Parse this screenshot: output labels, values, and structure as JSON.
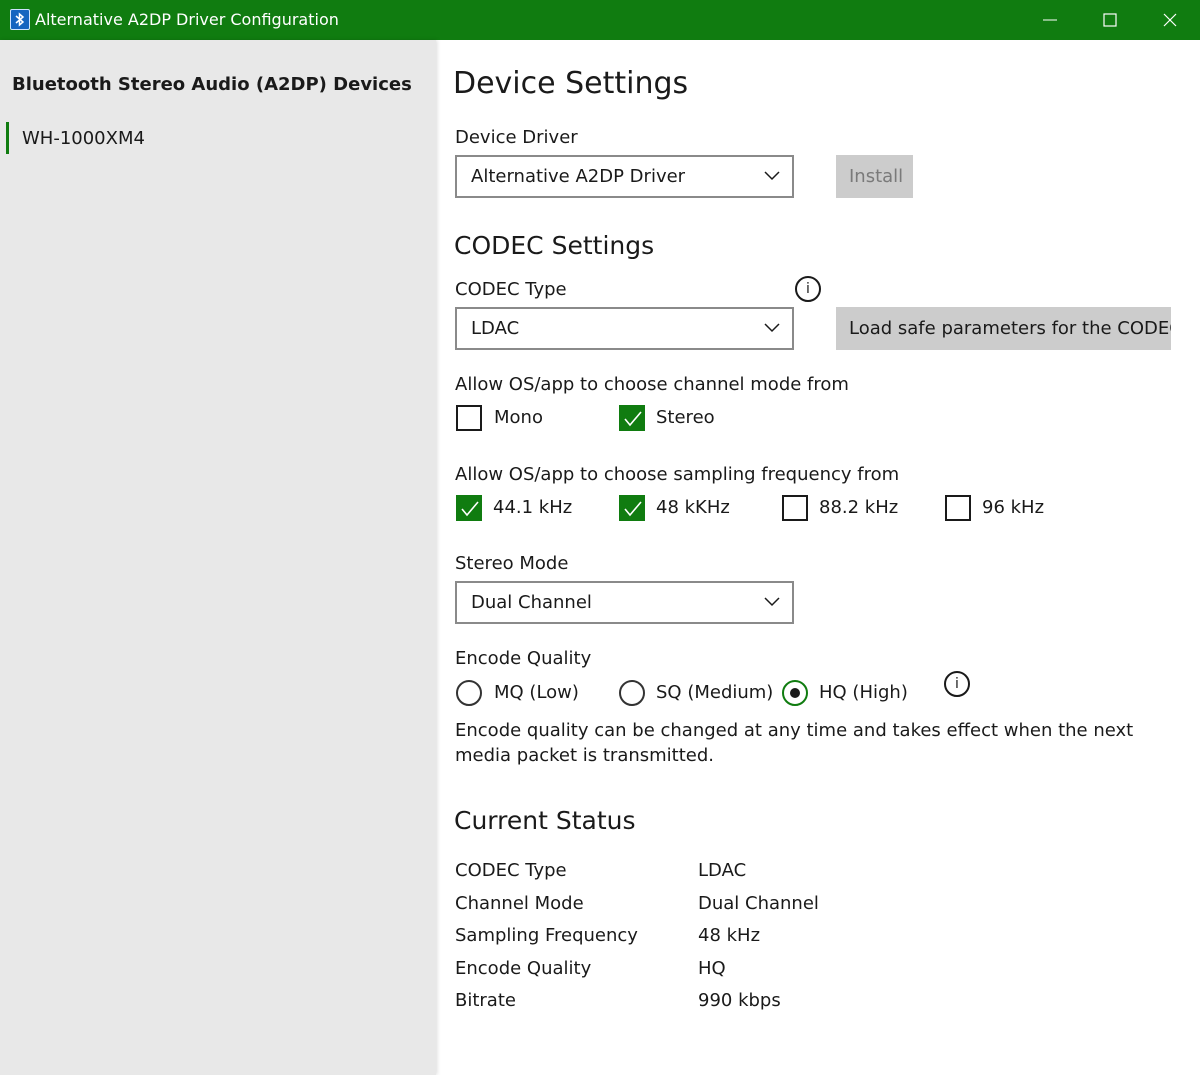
{
  "window": {
    "title": "Alternative A2DP Driver Configuration"
  },
  "sidebar": {
    "title": "Bluetooth Stereo Audio (A2DP) Devices",
    "devices": [
      {
        "label": "WH-1000XM4",
        "selected": true
      }
    ]
  },
  "device_settings": {
    "heading": "Device Settings",
    "driver_label": "Device Driver",
    "driver_value": "Alternative A2DP Driver",
    "install_label": "Install"
  },
  "codec_settings": {
    "heading": "CODEC Settings",
    "codec_type_label": "CODEC Type",
    "codec_type_value": "LDAC",
    "load_safe_label": "Load safe parameters for the CODEC",
    "channel_mode_label": "Allow OS/app to choose channel mode from",
    "channel_modes": [
      {
        "label": "Mono",
        "checked": false
      },
      {
        "label": "Stereo",
        "checked": true
      }
    ],
    "sampling_label": "Allow OS/app to choose sampling frequency from",
    "sampling_freqs": [
      {
        "label": "44.1 kHz",
        "checked": true
      },
      {
        "label": "48 kKHz",
        "checked": true
      },
      {
        "label": "88.2 kHz",
        "checked": false
      },
      {
        "label": "96 kHz",
        "checked": false
      }
    ],
    "stereo_mode_label": "Stereo Mode",
    "stereo_mode_value": "Dual Channel",
    "encode_quality_label": "Encode Quality",
    "encode_qualities": [
      {
        "label": "MQ (Low)",
        "selected": false
      },
      {
        "label": "SQ (Medium)",
        "selected": false
      },
      {
        "label": "HQ (High)",
        "selected": true
      }
    ],
    "encode_note": "Encode quality can be changed at any time and takes effect when the next media packet is transmitted."
  },
  "current_status": {
    "heading": "Current Status",
    "rows": [
      {
        "key": "CODEC Type",
        "value": "LDAC"
      },
      {
        "key": "Channel Mode",
        "value": "Dual Channel"
      },
      {
        "key": "Sampling Frequency",
        "value": "48 kHz"
      },
      {
        "key": "Encode Quality",
        "value": "HQ"
      },
      {
        "key": "Bitrate",
        "value": "990 kbps"
      }
    ]
  },
  "icons": {
    "app": "bluetooth-app-icon",
    "info": "info-icon",
    "dropdown": "chevron-down-icon",
    "check": "checkmark-icon"
  },
  "colors": {
    "accent": "#107c10",
    "titlebar": "#107c10",
    "sidebar_bg": "#e8e8e8",
    "button_bg": "#cccccc",
    "disabled_text": "#7a7a7a"
  }
}
